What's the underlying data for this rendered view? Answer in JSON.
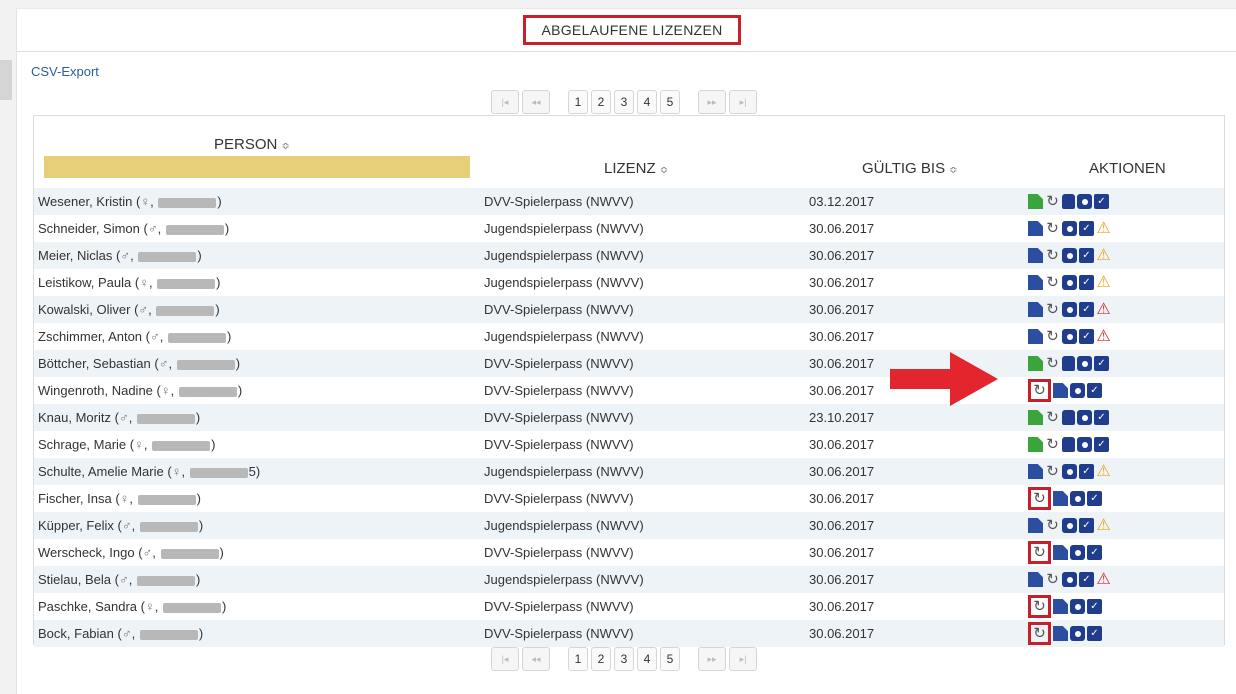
{
  "title": "ABGELAUFENE LIZENZEN",
  "csv_export": "CSV-Export",
  "pager": {
    "first": "|◂",
    "prev": "◂◂",
    "pages": [
      "1",
      "2",
      "3",
      "4",
      "5"
    ],
    "next": "▸▸",
    "last": "▸|"
  },
  "columns": {
    "person": "PERSON",
    "lizenz": "LIZENZ",
    "gueltig": "GÜLTIG BIS",
    "aktionen": "AKTIONEN",
    "sort_icon": "≎"
  },
  "colors": {
    "highlight": "#c8202a",
    "doc_blue": "#2b4ea1",
    "doc_green": "#3aa53a",
    "warn_yellow": "#e6a817",
    "warn_red": "#d42b2b",
    "filter_bar": "#e7cf7a",
    "link": "#2a5d9c"
  },
  "rows": [
    {
      "name": "Wesener, Kristin",
      "gender": "♀",
      "suffix": ")",
      "lizenz": "DVV-Spielerpass (NWVV)",
      "datum": "03.12.2017",
      "actions": [
        "doc-green",
        "refresh",
        "hand",
        "camera",
        "check"
      ]
    },
    {
      "name": "Schneider, Simon",
      "gender": "♂",
      "suffix": ")",
      "lizenz": "Jugendspielerpass (NWVV)",
      "datum": "30.06.2017",
      "actions": [
        "doc",
        "refresh",
        "camera",
        "check",
        "warn-yellow"
      ]
    },
    {
      "name": "Meier, Niclas",
      "gender": "♂",
      "suffix": ")",
      "lizenz": "Jugendspielerpass (NWVV)",
      "datum": "30.06.2017",
      "actions": [
        "doc",
        "refresh",
        "camera",
        "check",
        "warn-yellow"
      ]
    },
    {
      "name": "Leistikow, Paula",
      "gender": "♀",
      "suffix": ")",
      "lizenz": "Jugendspielerpass (NWVV)",
      "datum": "30.06.2017",
      "actions": [
        "doc",
        "refresh",
        "camera",
        "check",
        "warn-yellow"
      ]
    },
    {
      "name": "Kowalski, Oliver",
      "gender": "♂",
      "suffix": ")",
      "lizenz": "DVV-Spielerpass (NWVV)",
      "datum": "30.06.2017",
      "actions": [
        "doc",
        "refresh",
        "camera",
        "check",
        "warn-red"
      ]
    },
    {
      "name": "Zschimmer, Anton",
      "gender": "♂",
      "suffix": ")",
      "lizenz": "Jugendspielerpass (NWVV)",
      "datum": "30.06.2017",
      "actions": [
        "doc",
        "refresh",
        "camera",
        "check",
        "warn-red"
      ]
    },
    {
      "name": "Böttcher, Sebastian",
      "gender": "♂",
      "suffix": ")",
      "lizenz": "DVV-Spielerpass (NWVV)",
      "datum": "30.06.2017",
      "actions": [
        "doc-green",
        "refresh",
        "hand",
        "camera",
        "check"
      ]
    },
    {
      "name": "Wingenroth, Nadine",
      "gender": "♀",
      "suffix": ")",
      "lizenz": "DVV-Spielerpass (NWVV)",
      "datum": "30.06.2017",
      "actions": [
        "refresh-hl",
        "doc",
        "camera",
        "check"
      ]
    },
    {
      "name": "Knau, Moritz",
      "gender": "♂",
      "suffix": ")",
      "lizenz": "DVV-Spielerpass (NWVV)",
      "datum": "23.10.2017",
      "actions": [
        "doc-green",
        "refresh",
        "hand",
        "camera",
        "check"
      ]
    },
    {
      "name": "Schrage, Marie",
      "gender": "♀",
      "suffix": ")",
      "lizenz": "DVV-Spielerpass (NWVV)",
      "datum": "30.06.2017",
      "actions": [
        "doc-green",
        "refresh",
        "hand",
        "camera",
        "check"
      ]
    },
    {
      "name": "Schulte, Amelie Marie",
      "gender": "♀",
      "suffix": "5)",
      "lizenz": "Jugendspielerpass (NWVV)",
      "datum": "30.06.2017",
      "actions": [
        "doc",
        "refresh",
        "camera",
        "check",
        "warn-yellow"
      ]
    },
    {
      "name": "Fischer, Insa",
      "gender": "♀",
      "suffix": ")",
      "lizenz": "DVV-Spielerpass (NWVV)",
      "datum": "30.06.2017",
      "actions": [
        "refresh-hl",
        "doc",
        "camera",
        "check"
      ]
    },
    {
      "name": "Küpper, Felix",
      "gender": "♂",
      "suffix": ")",
      "lizenz": "Jugendspielerpass (NWVV)",
      "datum": "30.06.2017",
      "actions": [
        "doc",
        "refresh",
        "camera",
        "check",
        "warn-yellow"
      ]
    },
    {
      "name": "Werscheck, Ingo",
      "gender": "♂",
      "suffix": ")",
      "lizenz": "DVV-Spielerpass (NWVV)",
      "datum": "30.06.2017",
      "actions": [
        "refresh-hl",
        "doc",
        "camera",
        "check"
      ]
    },
    {
      "name": "Stielau, Bela",
      "gender": "♂",
      "suffix": ")",
      "lizenz": "Jugendspielerpass (NWVV)",
      "datum": "30.06.2017",
      "actions": [
        "doc",
        "refresh",
        "camera",
        "check",
        "warn-red"
      ]
    },
    {
      "name": "Paschke, Sandra",
      "gender": "♀",
      "suffix": ")",
      "lizenz": "DVV-Spielerpass (NWVV)",
      "datum": "30.06.2017",
      "actions": [
        "refresh-hl",
        "doc",
        "camera",
        "check"
      ]
    },
    {
      "name": "Bock, Fabian",
      "gender": "♂",
      "suffix": ")",
      "lizenz": "DVV-Spielerpass (NWVV)",
      "datum": "30.06.2017",
      "actions": [
        "refresh-hl",
        "doc",
        "camera",
        "check"
      ]
    }
  ]
}
